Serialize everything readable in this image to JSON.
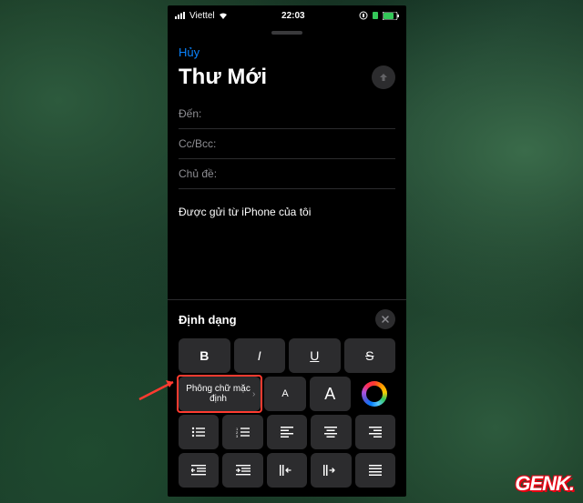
{
  "statusbar": {
    "carrier": "Viettel",
    "time": "22:03"
  },
  "compose": {
    "cancel": "Hủy",
    "title": "Thư Mới",
    "to_label": "Đến:",
    "ccbcc_label": "Cc/Bcc:",
    "subject_label": "Chủ đề:",
    "signature": "Được gửi từ iPhone của tôi"
  },
  "format": {
    "title": "Định dạng",
    "bold": "B",
    "italic": "I",
    "underline": "U",
    "strike": "S",
    "font_default": "Phông chữ mặc định",
    "size_small": "A",
    "size_big": "A"
  },
  "watermark": "GENK"
}
